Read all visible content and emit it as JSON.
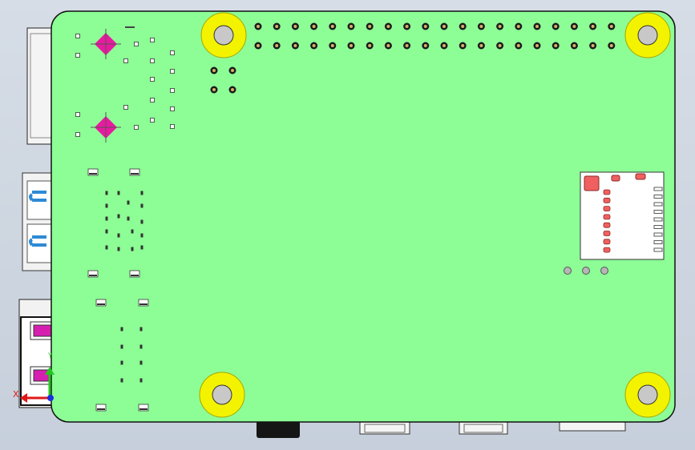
{
  "scene": {
    "description_none": "",
    "board_color": "#8dfe96",
    "board_outline": "#111111",
    "mount_hole_color": "#f3f300",
    "mount_hole_ring": "#9a9a00",
    "usb_port_accent": "#2e8ad6",
    "ethernet_accent": "#d61fb0",
    "fiducial_color": "#e81aa0",
    "sd_pad_color": "#f06060",
    "background_color": "#cfd6e0"
  },
  "gpio": {
    "rows": 2,
    "columns": 20
  },
  "triad": {
    "x_label": "X",
    "y_label": "Y",
    "x_color": "#e01818",
    "y_color": "#22c81e",
    "z_color": "#1830e0"
  }
}
